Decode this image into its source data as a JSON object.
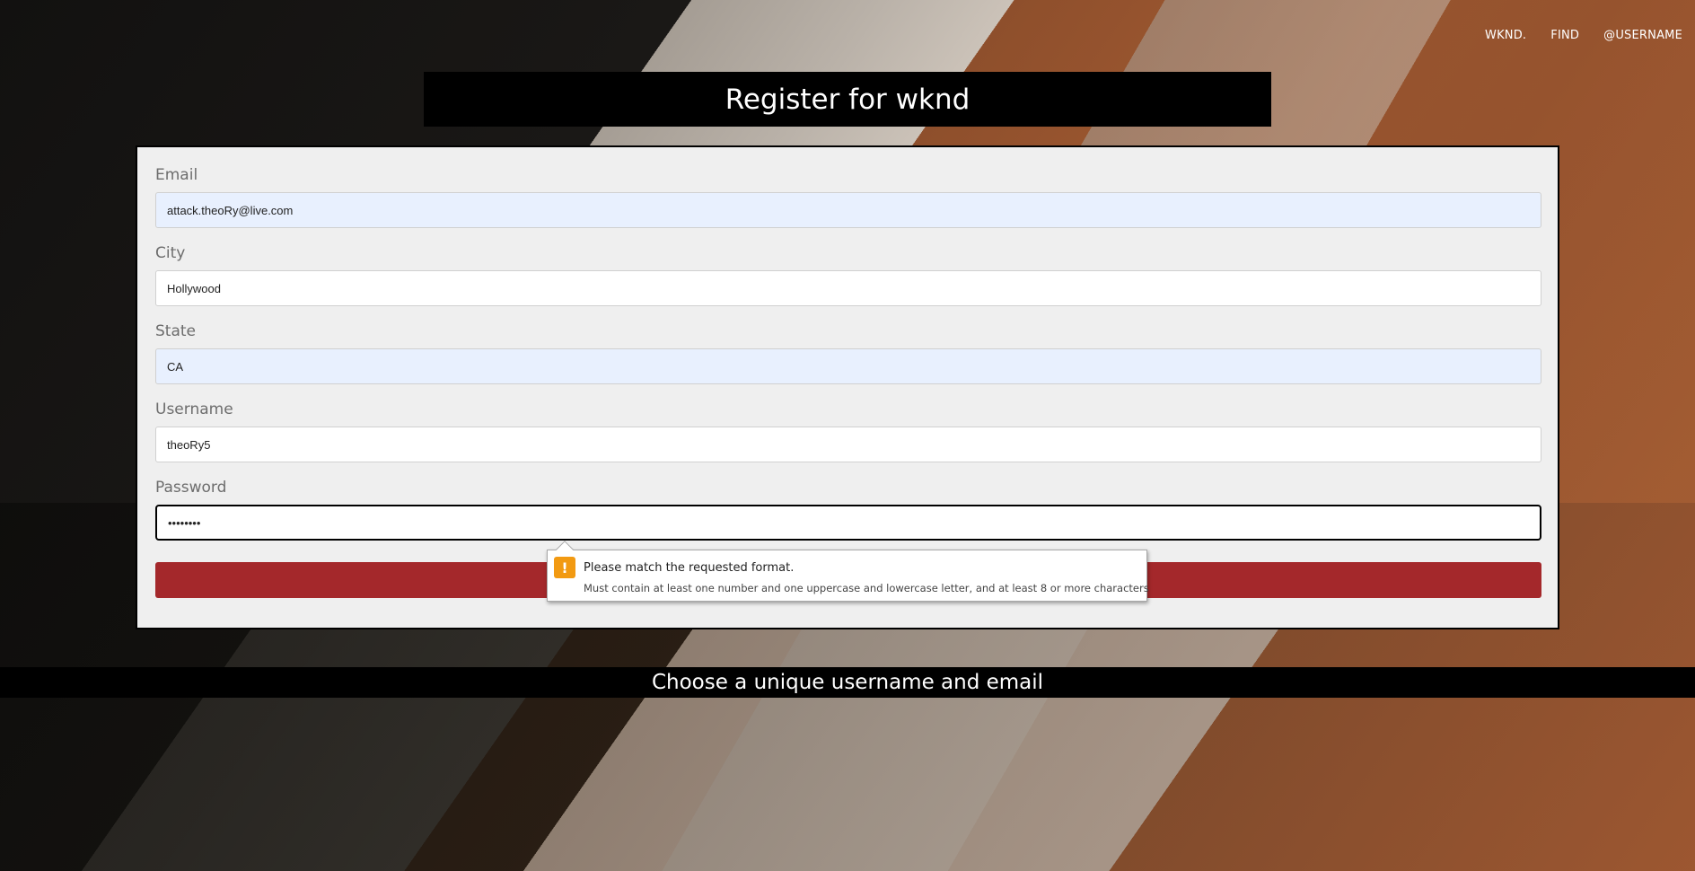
{
  "nav": {
    "items": [
      {
        "label": "WKND."
      },
      {
        "label": "FIND"
      },
      {
        "label": "@USERNAME"
      }
    ]
  },
  "page": {
    "title": "Register for wknd",
    "footer_text": "Choose a unique username and email"
  },
  "form": {
    "email": {
      "label": "Email",
      "value": "attack.theoRy@live.com"
    },
    "city": {
      "label": "City",
      "value": "Hollywood"
    },
    "state": {
      "label": "State",
      "value": "CA"
    },
    "username": {
      "label": "Username",
      "value": "theoRy5"
    },
    "password": {
      "label": "Password",
      "value": "••••••••"
    },
    "submit_label": ""
  },
  "validation_tooltip": {
    "title": "Please match the requested format.",
    "detail": "Must contain at least one number and one uppercase and lowercase letter, and at least 8 or more characters",
    "icon": "warning-icon"
  },
  "colors": {
    "title_bar": "#000000",
    "panel": "#efefef",
    "submit_button": "#a4282b",
    "autofill": "#e8f0fe",
    "warning": "#f29a12"
  }
}
